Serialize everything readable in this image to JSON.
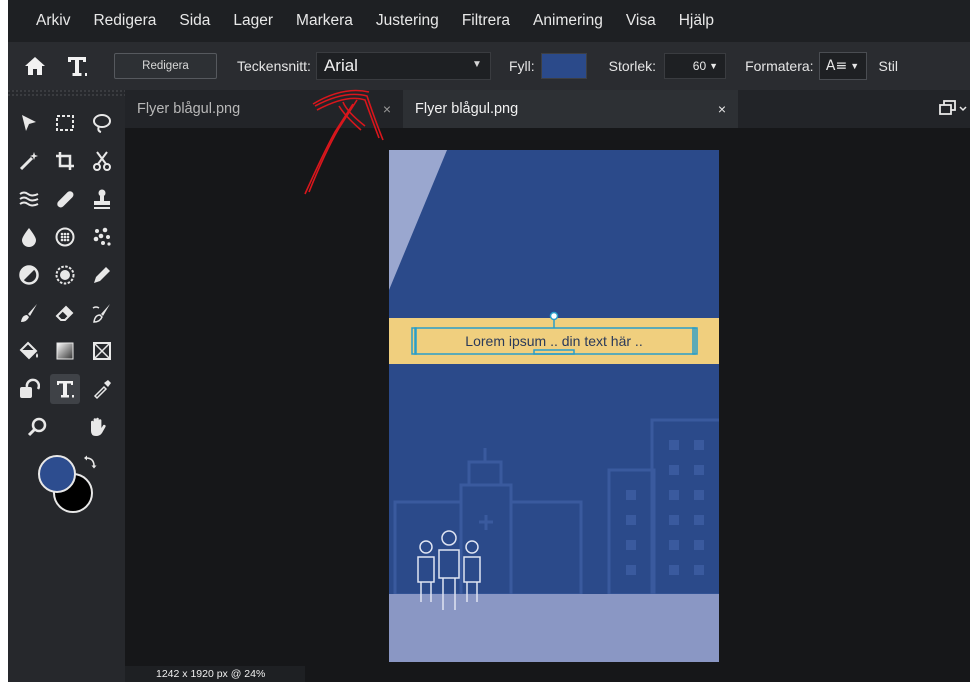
{
  "menu": [
    "Arkiv",
    "Redigera",
    "Sida",
    "Lager",
    "Markera",
    "Justering",
    "Filtrera",
    "Animering",
    "Visa",
    "Hjälp"
  ],
  "options": {
    "edit_button": "Redigera",
    "font_label": "Teckensnitt:",
    "font_value": "Arial",
    "fill_label": "Fyll:",
    "fill_color": "#2b4a8a",
    "size_label": "Storlek:",
    "size_value": "60",
    "format_label": "Formatera:",
    "style_label_partial": "Stil"
  },
  "tools": [
    "move",
    "rect-select",
    "lasso",
    "magic-wand",
    "crop",
    "cut",
    "liquify",
    "healing",
    "stamp",
    "blur",
    "sponge",
    "dots",
    "dodge",
    "burn",
    "color-picker",
    "brush",
    "eraser",
    "smudge",
    "paint-bucket",
    "gradient",
    "frame",
    "shape",
    "text",
    "eyedropper",
    "zoom",
    "hand"
  ],
  "colors": {
    "foreground": "#2d4d8f",
    "background": "#000000",
    "accent": "#2b4a8a"
  },
  "tabs": [
    {
      "label": "Flyer blågul.png",
      "close": "×",
      "active": false
    },
    {
      "label": "Flyer blågul.png",
      "close": "×",
      "active": true
    }
  ],
  "document": {
    "text_layer": "Lorem ipsum .. din text här ..",
    "background_color": "#2b4a8a",
    "banner_color": "#f0cf7e",
    "ground_color": "#8a97c4"
  },
  "status": "1242 x 1920 px @ 24%"
}
